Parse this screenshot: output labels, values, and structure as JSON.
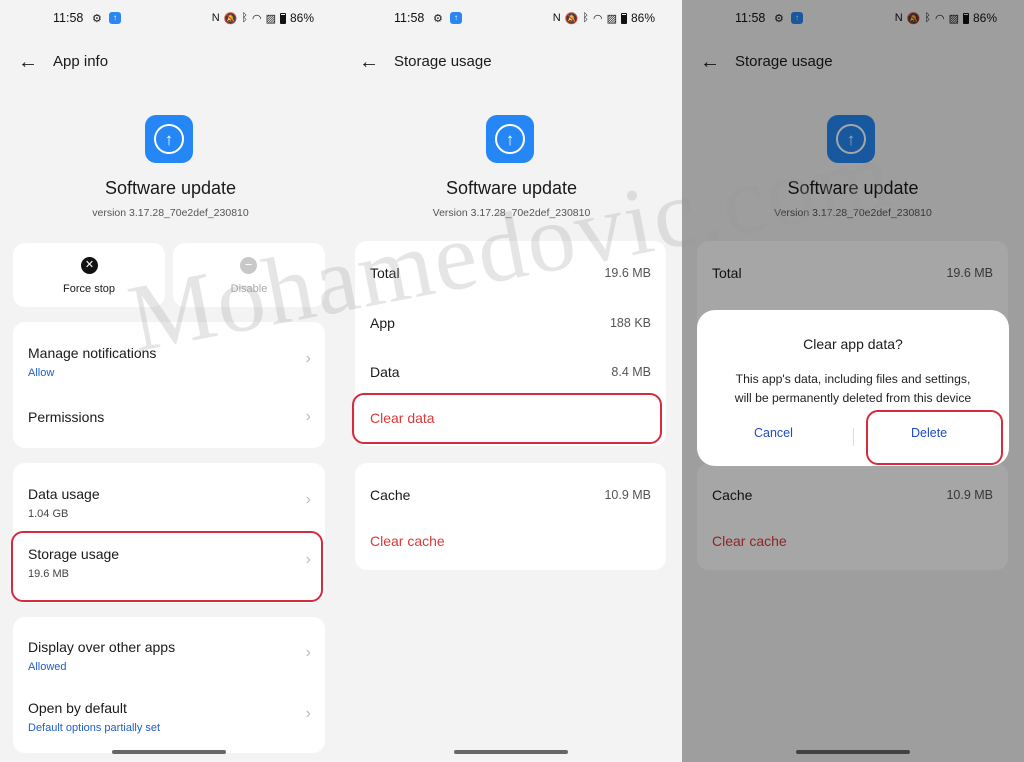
{
  "status": {
    "time": "11:58",
    "battery": "86%"
  },
  "app": {
    "name": "Software update",
    "version_p1": "version 3.17.28_70e2def_230810",
    "version_p2": "Version 3.17.28_70e2def_230810"
  },
  "panel1": {
    "title": "App info",
    "force_stop": "Force stop",
    "disable": "Disable",
    "manage_notifications": "Manage notifications",
    "manage_notifications_sub": "Allow",
    "permissions": "Permissions",
    "data_usage": "Data usage",
    "data_usage_sub": "1.04 GB",
    "storage_usage": "Storage usage",
    "storage_usage_sub": "19.6 MB",
    "display_over": "Display over other apps",
    "display_over_sub": "Allowed",
    "open_default": "Open by default",
    "open_default_sub": "Default options partially set"
  },
  "storage": {
    "title": "Storage usage",
    "total_label": "Total",
    "total_value": "19.6 MB",
    "app_label": "App",
    "app_value": "188 KB",
    "data_label": "Data",
    "data_value": "8.4 MB",
    "clear_data": "Clear data",
    "cache_label": "Cache",
    "cache_value": "10.9 MB",
    "clear_cache": "Clear cache"
  },
  "dialog": {
    "title": "Clear app data?",
    "message_line1": "This app's data, including files and settings,",
    "message_line2": "will be permanently deleted from this device",
    "cancel": "Cancel",
    "delete": "Delete"
  },
  "watermark": "Mohamedovic.com",
  "colors": {
    "accent_blue": "#2487f5",
    "highlight_red": "#d62b3c",
    "link_blue": "#1f5fc8",
    "action_red": "#d93a3a"
  }
}
